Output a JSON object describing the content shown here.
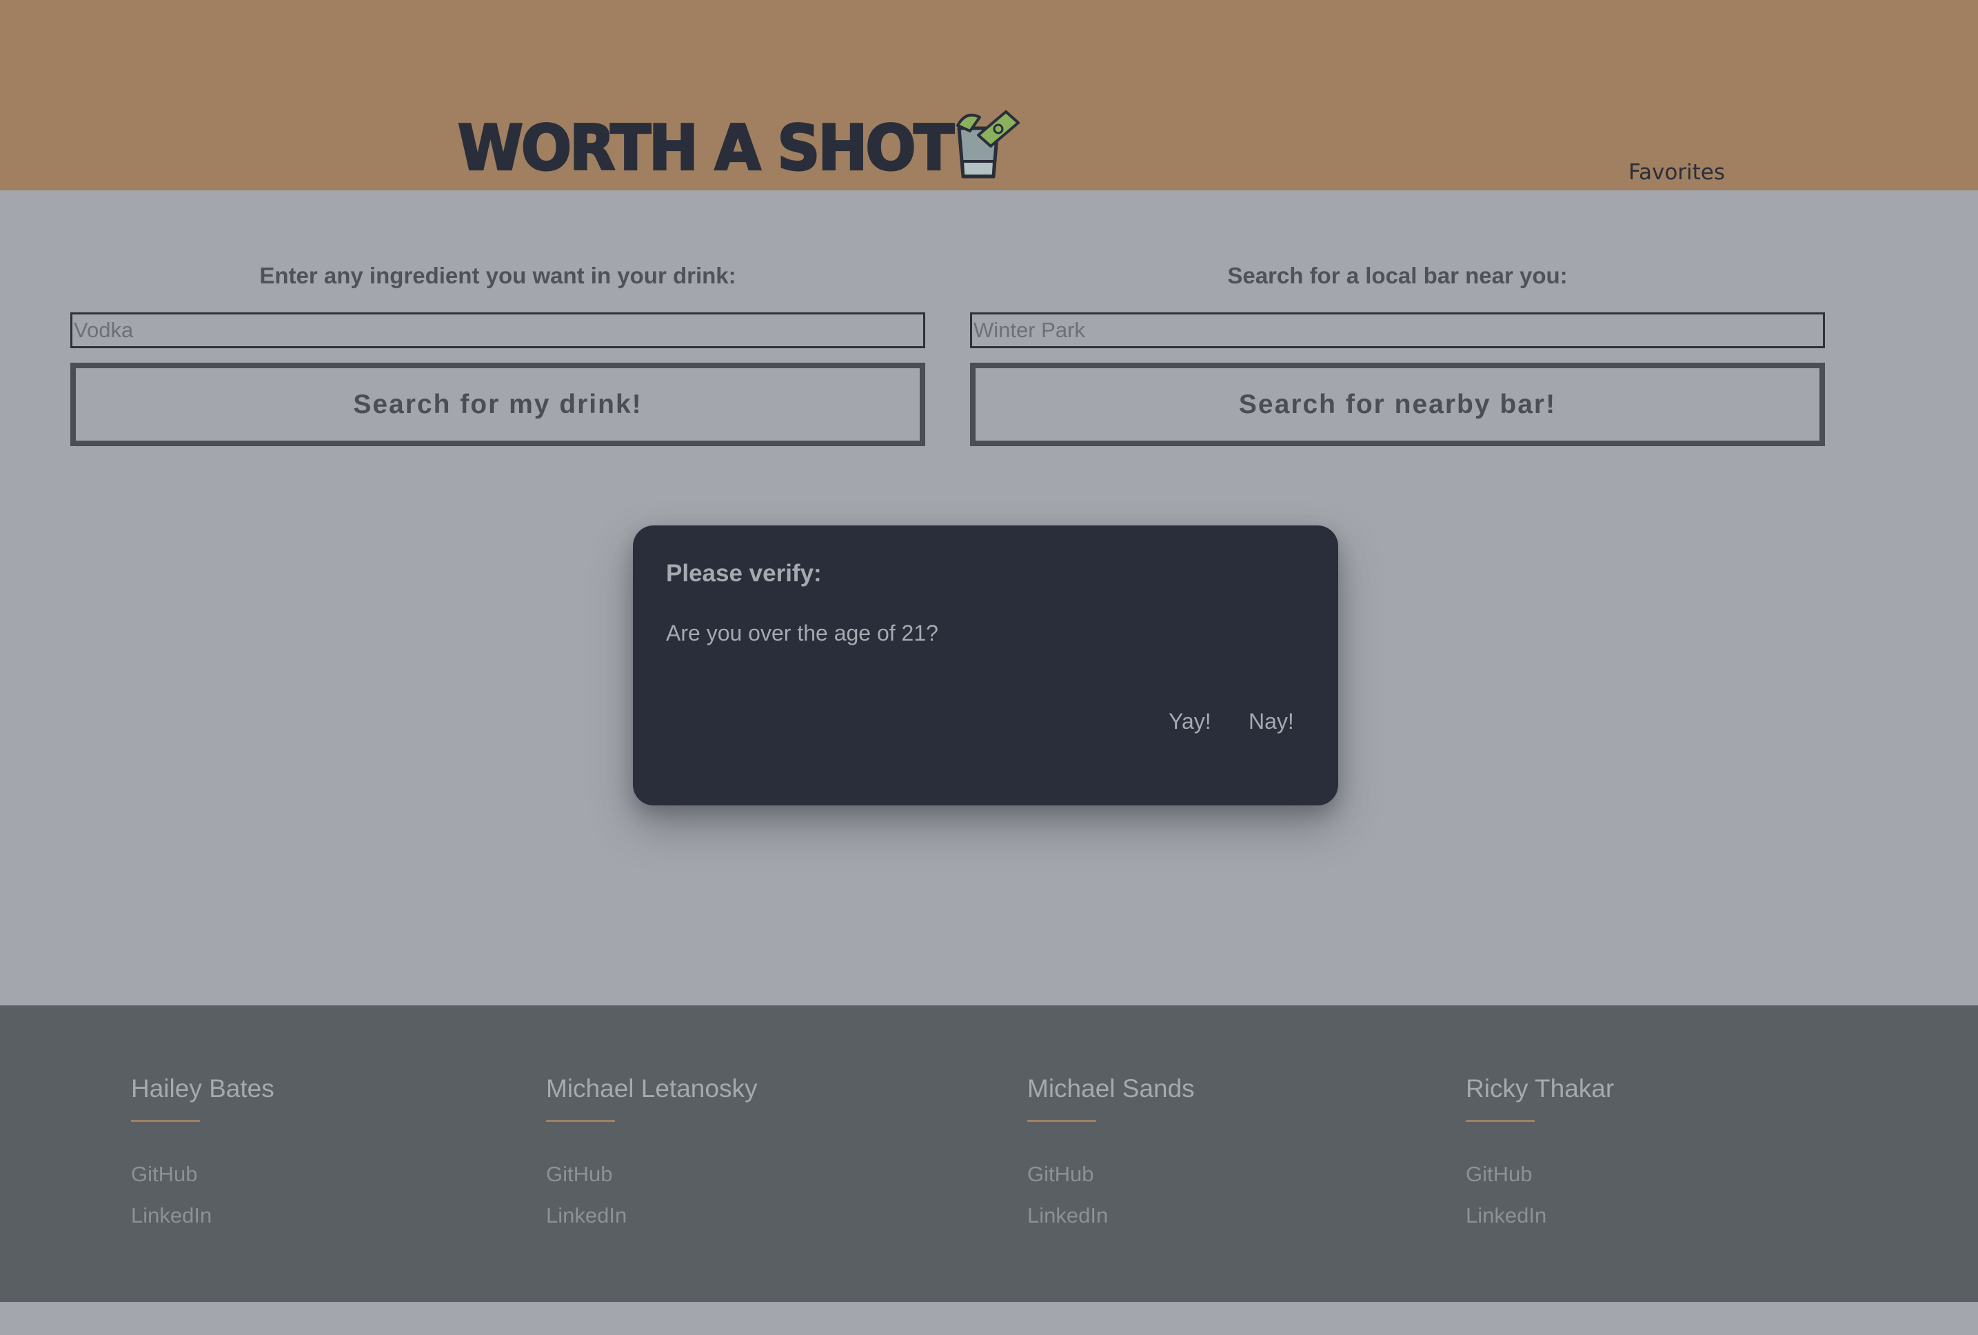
{
  "header": {
    "logo_text": "WORTH A SHOT",
    "logo_icon": "shot-glass-icon",
    "nav": {
      "favorites": "Favorites"
    }
  },
  "drink_search": {
    "label": "Enter any ingredient you want in your drink:",
    "placeholder": "Vodka",
    "value": "",
    "button": "Search for my drink!"
  },
  "bar_search": {
    "label": "Search for a local bar near you:",
    "placeholder": "Winter Park",
    "value": "",
    "button": "Search for nearby bar!"
  },
  "modal": {
    "title": "Please verify:",
    "body": "Are you over the age of 21?",
    "yes": "Yay!",
    "no": "Nay!"
  },
  "footer": {
    "members": [
      {
        "name": "Hailey Bates",
        "github": "GitHub",
        "linkedin": "LinkedIn"
      },
      {
        "name": "Michael Letanosky",
        "github": "GitHub",
        "linkedin": "LinkedIn"
      },
      {
        "name": "Michael Sands",
        "github": "GitHub",
        "linkedin": "LinkedIn"
      },
      {
        "name": "Ricky Thakar",
        "github": "GitHub",
        "linkedin": "LinkedIn"
      }
    ]
  },
  "colors": {
    "header_bg": "#a08061",
    "page_bg": "#a3a6ac",
    "modal_bg": "#292e3a",
    "footer_bg": "#5a5f63",
    "accent": "#a08061"
  }
}
